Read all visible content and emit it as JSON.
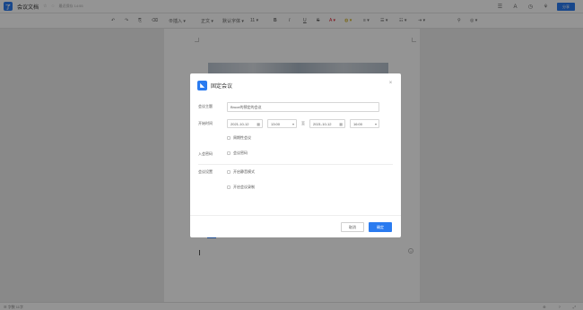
{
  "app": {
    "logo_glyph": "了",
    "title": "会议文档",
    "star_icon": "☆",
    "more_icon": "◌",
    "saved_status": "最近保存 14:55"
  },
  "topbar": {
    "icons": [
      "menu-icon",
      "text-style-icon",
      "history-icon",
      "share-network-icon"
    ],
    "share_label": "分享"
  },
  "toolbar": {
    "undo": "↶",
    "redo": "↷",
    "format_painter": "⎘",
    "clear_format": "⌫",
    "insert": "⊕插入 ▾",
    "text_style": "正文 ▾",
    "font_family": "默认字体 ▾",
    "font_size": "11 ▾",
    "bold": "B",
    "italic": "I",
    "underline": "U",
    "strike": "S",
    "font_color": "A ▾",
    "highlight": "◍ ▾",
    "align": "≡ ▾",
    "list": "☰ ▾",
    "bullets": "☷ ▾",
    "indent": "⇥ ▾",
    "link": "⚲",
    "comment": "◎ ▾"
  },
  "bottombar": {
    "left": "☰ 字数 11字",
    "zoom": "⊕",
    "help": "?",
    "fullscreen": "⤢"
  },
  "modal": {
    "logo_glyph": "◣",
    "title": "固定会议",
    "close_icon": "×",
    "fields": {
      "subject_label": "会议主题",
      "subject_value": "Bruce的预定的会议",
      "time_label": "开始时间",
      "start_date": "2021-10-12",
      "start_time": "13:00",
      "to_label": "至",
      "end_date": "2021-10-12",
      "end_time": "16:00",
      "calendar_icon": "▦",
      "chevron_icon": "▾",
      "repeat_label": "周期性会议",
      "participants_label": "入会密码",
      "password_option": "会议密码",
      "settings_label": "会议设置",
      "option_mute": "开启静音模式",
      "option_record": "开启会议录制"
    },
    "buttons": {
      "cancel": "取消",
      "confirm": "确定"
    }
  }
}
